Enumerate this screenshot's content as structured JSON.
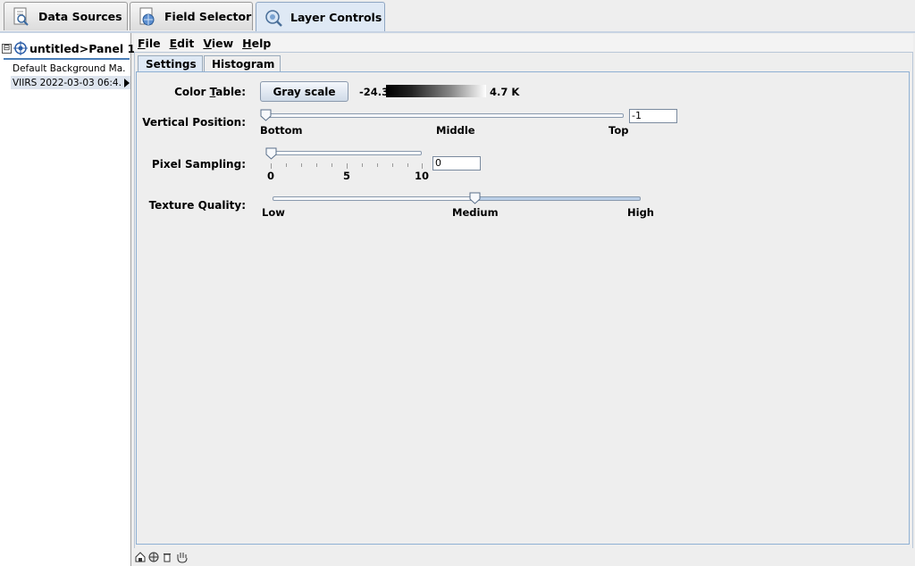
{
  "top_tabs": [
    {
      "label": "Data Sources",
      "icon": "document-search-icon"
    },
    {
      "label": "Field Selector",
      "icon": "globe-document-icon"
    },
    {
      "label": "Layer Controls",
      "icon": "magnifier-layers-icon",
      "active": true
    }
  ],
  "tree": {
    "root_label": "untitled>Panel 1",
    "expand_glyph": "⊟",
    "items": [
      {
        "label": "Default Background Ma."
      },
      {
        "label": "VIIRS 2022-03-03 06:4.",
        "selected": true
      }
    ]
  },
  "menubar": [
    {
      "label": "File",
      "mnemonic": "F",
      "rest": "ile"
    },
    {
      "label": "Edit",
      "mnemonic": "E",
      "rest": "dit"
    },
    {
      "label": "View",
      "mnemonic": "V",
      "rest": "iew"
    },
    {
      "label": "Help",
      "mnemonic": "H",
      "rest": "elp"
    }
  ],
  "inner_tabs": [
    {
      "label": "Settings",
      "active": true
    },
    {
      "label": "Histogram"
    }
  ],
  "settings": {
    "color_table": {
      "label_pre": "Color ",
      "label_mnemonic": "T",
      "label_post": "able:",
      "button_label": "Gray scale",
      "range_min": "-24.3",
      "range_max": "4.7 K"
    },
    "vertical_position": {
      "label": "Vertical Position:",
      "value": "-1",
      "ticks": [
        "Bottom",
        "Middle",
        "Top"
      ]
    },
    "pixel_sampling": {
      "label": "Pixel Sampling:",
      "value": "0",
      "ticks": [
        "0",
        "5",
        "10"
      ]
    },
    "texture_quality": {
      "label": "Texture Quality:",
      "ticks": [
        "Low",
        "Medium",
        "High"
      ],
      "selected": "Medium"
    }
  },
  "status_icons": [
    "home-globe-icon",
    "projection-icon",
    "trash-icon",
    "hand-icon"
  ],
  "colors": {
    "accent": "#4b7fb8",
    "tab_active": "#dfe9f5"
  }
}
